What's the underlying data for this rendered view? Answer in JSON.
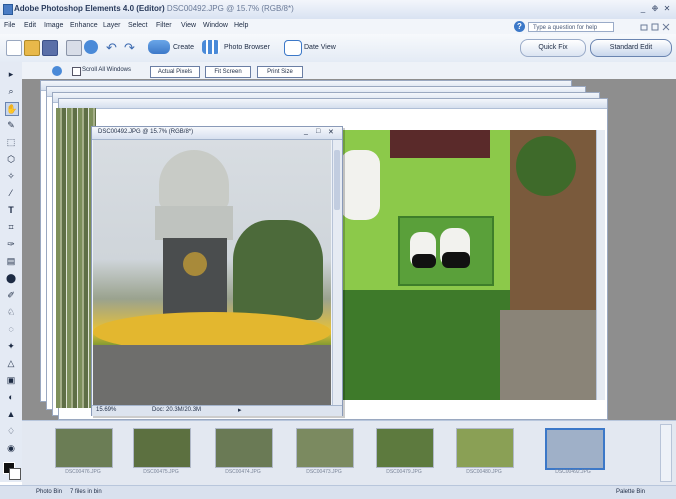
{
  "app": {
    "title": "Adobe Photoshop Elements 4.0 (Editor)",
    "subtitle": "DSC00492.JPG @ 15.7% (RGB/8*)",
    "window_buttons": [
      "_",
      "❉",
      "✕"
    ]
  },
  "menu": {
    "items": [
      "File",
      "Edit",
      "Image",
      "Enhance",
      "Layer",
      "Select",
      "Filter",
      "View",
      "Window",
      "Help"
    ],
    "help_placeholder": "Type a question for help"
  },
  "shortcuts": {
    "create": "Create",
    "photo_browser": "Photo Browser",
    "date_view": "Date View",
    "quick_fix": "Quick Fix",
    "standard_edit": "Standard Edit"
  },
  "options": {
    "scroll_all": "Scroll All Windows",
    "actual_pixels": "Actual Pixels",
    "fit_screen": "Fit Screen",
    "print_size": "Print Size"
  },
  "tools": [
    "▸",
    "⌕",
    "✋",
    "✎",
    "⬚",
    "⬡",
    "✧",
    "⁄",
    "T",
    "⌗",
    "✑",
    "▤",
    "⬤",
    "✐",
    "♘",
    "◌",
    "✦",
    "△",
    "▣",
    "◐",
    "▲",
    "♢",
    "◉"
  ],
  "document": {
    "title": "DSC00492.JPG @ 15.7% (RGB/8*)",
    "zoom": "15.69%",
    "doc_size": "Doc: 20.3M/20.3M",
    "controls": [
      "_",
      "□",
      "✕"
    ]
  },
  "photo_bin": {
    "thumbnails": [
      {
        "label": "DSC00476.JPG",
        "color": "#6b7d55"
      },
      {
        "label": "DSC00475.JPG",
        "color": "#5c7040"
      },
      {
        "label": "DSC00474.JPG",
        "color": "#6a7a55"
      },
      {
        "label": "DSC00473.JPG",
        "color": "#7b8a60"
      },
      {
        "label": "DSC00479.JPG",
        "color": "#5d7a3e"
      },
      {
        "label": "DSC00480.JPG",
        "color": "#8aa055"
      },
      {
        "label": "DSC00492.JPG",
        "color": "#9fb0c8"
      }
    ]
  },
  "status": {
    "photo_bin": "Photo Bin",
    "files": "7 files in bin",
    "palette_bin": "Palette Bin"
  },
  "colors": {
    "accent": "#3c78c8",
    "workspace": "#8e8e8e",
    "chrome": "#e4eaf4"
  }
}
